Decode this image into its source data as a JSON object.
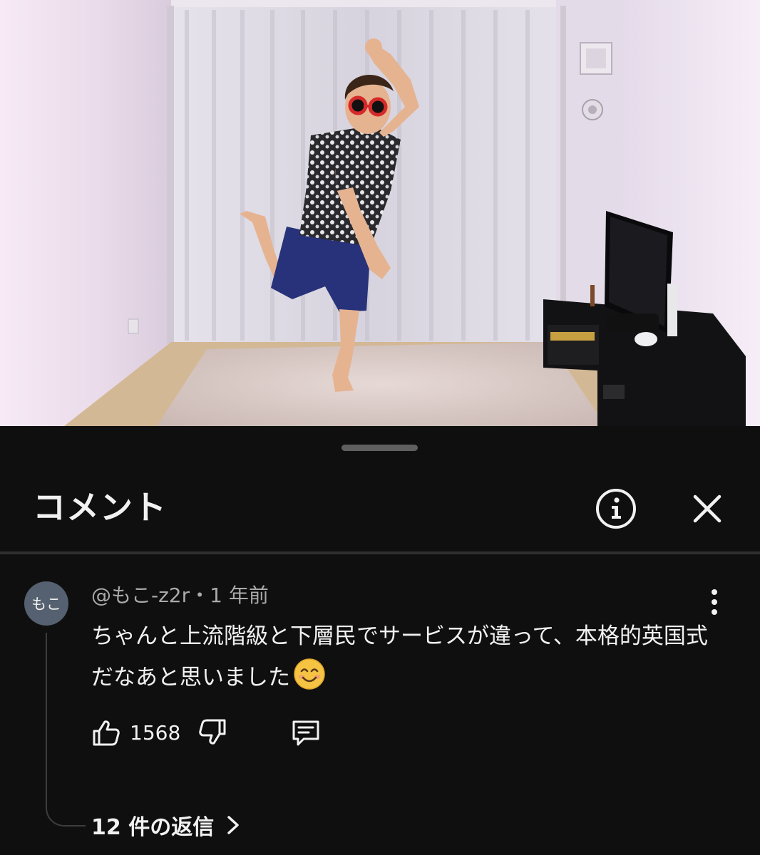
{
  "sheet": {
    "title": "コメント",
    "icons": {
      "info": "info-circle-icon",
      "close": "close-x-icon"
    }
  },
  "comment": {
    "avatar_text": "もこ",
    "meta": "@もこ-z2r・1 年前",
    "text": "ちゃんと上流階級と下層民でサービスが違って、本格的英国式だなあと思いました",
    "emoji": "smiling-face-icon",
    "likes": "1568",
    "icons": {
      "like": "thumbs-up-icon",
      "dislike": "thumbs-down-icon",
      "reply": "reply-comment-icon",
      "more": "more-vertical-icon"
    },
    "replies_label": "12 件の返信"
  },
  "colors": {
    "background": "#0f0f0f",
    "text": "#f1f1f1",
    "secondary_text": "#aaaaaa",
    "avatar": "#556170"
  }
}
